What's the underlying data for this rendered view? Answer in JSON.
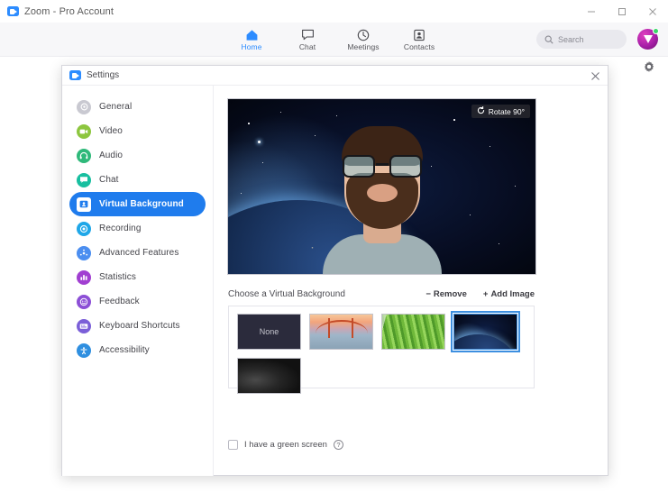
{
  "window": {
    "title": "Zoom - Pro Account",
    "logo_icon": "zoom-logo-icon",
    "minimize_icon": "minimize-icon",
    "maximize_icon": "maximize-icon",
    "close_icon": "close-icon"
  },
  "header": {
    "nav": [
      {
        "label": "Home",
        "icon": "home-icon",
        "active": true
      },
      {
        "label": "Chat",
        "icon": "chat-bubble-icon",
        "active": false
      },
      {
        "label": "Meetings",
        "icon": "clock-icon",
        "active": false
      },
      {
        "label": "Contacts",
        "icon": "contacts-icon",
        "active": false
      }
    ],
    "search": {
      "placeholder": "Search",
      "value": "",
      "icon": "search-icon"
    },
    "avatar": {
      "name": "user-avatar",
      "status": "available",
      "status_color": "#39d86a"
    },
    "settings_gear_icon": "gear-icon",
    "accent_color": "#2d8cff"
  },
  "dialog": {
    "title": "Settings",
    "logo_icon": "zoom-logo-icon",
    "close_icon": "close-icon",
    "sidebar": [
      {
        "label": "General",
        "icon": "gear-icon",
        "color": "#c9c9d1",
        "active": false
      },
      {
        "label": "Video",
        "icon": "video-camera-icon",
        "color": "#8dc63f",
        "active": false
      },
      {
        "label": "Audio",
        "icon": "headset-icon",
        "color": "#2fb97a",
        "active": false
      },
      {
        "label": "Chat",
        "icon": "chat-bubble-icon",
        "color": "#18bfa0",
        "active": false
      },
      {
        "label": "Virtual Background",
        "icon": "person-card-icon",
        "color": "#1f7ced",
        "active": true
      },
      {
        "label": "Recording",
        "icon": "record-icon",
        "color": "#1fa7e8",
        "active": false
      },
      {
        "label": "Advanced Features",
        "icon": "sparkle-icon",
        "color": "#4b8ef0",
        "active": false
      },
      {
        "label": "Statistics",
        "icon": "bar-chart-icon",
        "color": "#a13fd1",
        "active": false
      },
      {
        "label": "Feedback",
        "icon": "smiley-icon",
        "color": "#8c4fd6",
        "active": false
      },
      {
        "label": "Keyboard Shortcuts",
        "icon": "keyboard-icon",
        "color": "#7b5fd8",
        "active": false
      },
      {
        "label": "Accessibility",
        "icon": "accessibility-icon",
        "color": "#2f8fe0",
        "active": false
      }
    ],
    "preview": {
      "rotate_label": "Rotate 90°",
      "rotate_icon": "rotate-icon",
      "description": "self-view video preview with virtual background"
    },
    "virtual_background": {
      "section_title": "Choose a Virtual Background",
      "remove_label": "Remove",
      "remove_icon": "minus-icon",
      "add_label": "Add Image",
      "add_icon": "plus-icon",
      "thumbnails": [
        {
          "label": "None",
          "kind": "none",
          "selected": false
        },
        {
          "label": "",
          "kind": "bridge",
          "selected": false
        },
        {
          "label": "",
          "kind": "grass",
          "selected": false
        },
        {
          "label": "",
          "kind": "earth",
          "selected": true
        },
        {
          "label": "",
          "kind": "smoke",
          "selected": false
        }
      ],
      "selection_color": "#3d8fe0"
    },
    "green_screen": {
      "label": "I have a green screen",
      "checked": false,
      "help_icon": "question-mark-icon",
      "help_glyph": "?"
    }
  }
}
